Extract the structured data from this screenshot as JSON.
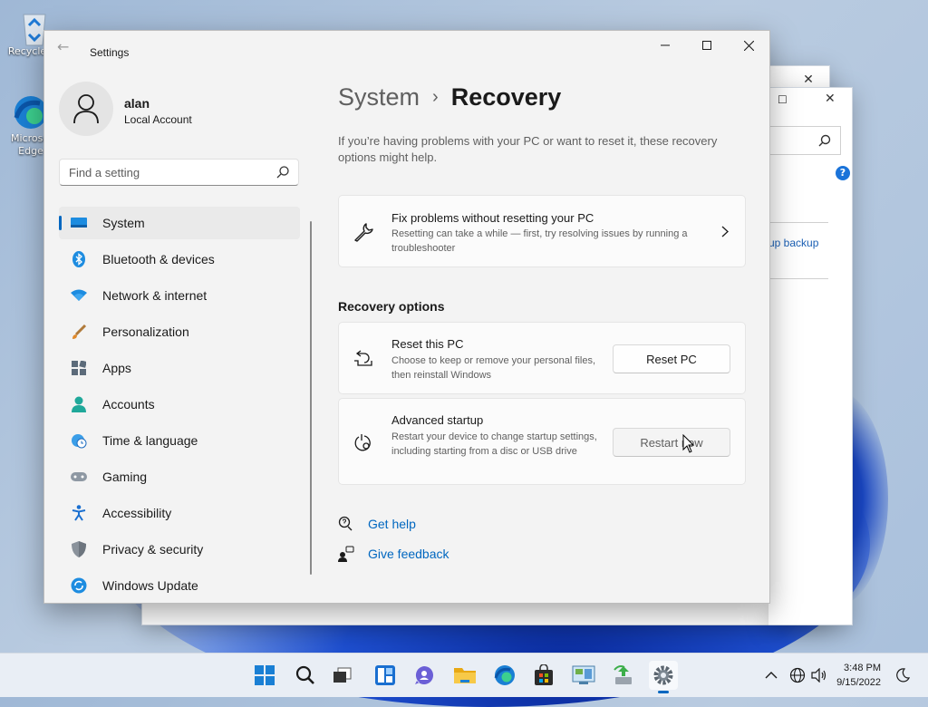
{
  "desktop": {
    "icons": [
      {
        "label": "Recycle",
        "icon": "recycle-bin-icon"
      },
      {
        "label": "Microsoft Edge",
        "icon": "edge-icon"
      }
    ]
  },
  "background_window": {
    "link_text": "up backup",
    "help_icon": "?"
  },
  "window": {
    "title": "Settings",
    "controls": [
      "minimize",
      "maximize",
      "close"
    ]
  },
  "profile": {
    "name": "alan",
    "account_type": "Local Account"
  },
  "search": {
    "placeholder": "Find a setting"
  },
  "nav": {
    "items": [
      {
        "label": "System",
        "icon": "monitor-icon",
        "active": true
      },
      {
        "label": "Bluetooth & devices",
        "icon": "bluetooth-icon"
      },
      {
        "label": "Network & internet",
        "icon": "wifi-icon"
      },
      {
        "label": "Personalization",
        "icon": "brush-icon"
      },
      {
        "label": "Apps",
        "icon": "apps-icon"
      },
      {
        "label": "Accounts",
        "icon": "person-icon"
      },
      {
        "label": "Time & language",
        "icon": "globe-clock-icon"
      },
      {
        "label": "Gaming",
        "icon": "gamepad-icon"
      },
      {
        "label": "Accessibility",
        "icon": "accessibility-icon"
      },
      {
        "label": "Privacy & security",
        "icon": "shield-icon"
      },
      {
        "label": "Windows Update",
        "icon": "update-icon"
      }
    ]
  },
  "breadcrumb": {
    "parent": "System",
    "separator": "›",
    "current": "Recovery"
  },
  "intro": "If you’re having problems with your PC or want to reset it, these recovery options might help.",
  "fix_card": {
    "title": "Fix problems without resetting your PC",
    "description": "Resetting can take a while — first, try resolving issues by running a troubleshooter",
    "icon": "wrench-icon"
  },
  "recovery_options": {
    "heading": "Recovery options",
    "reset": {
      "title": "Reset this PC",
      "description": "Choose to keep or remove your personal files, then reinstall Windows",
      "button": "Reset PC",
      "icon": "reset-pc-icon"
    },
    "advanced": {
      "title": "Advanced startup",
      "description": "Restart your device to change startup settings, including starting from a disc or USB drive",
      "button": "Restart now",
      "icon": "advanced-startup-icon"
    }
  },
  "links": [
    {
      "label": "Get help",
      "icon": "help-icon"
    },
    {
      "label": "Give feedback",
      "icon": "feedback-icon"
    }
  ],
  "taskbar": {
    "apps": [
      "start-icon",
      "search-icon",
      "task-view-icon",
      "widgets-icon",
      "chat-icon",
      "file-explorer-icon",
      "edge-icon",
      "store-icon",
      "control-panel-icon",
      "backup-icon",
      "settings-icon"
    ],
    "time": "3:48 PM",
    "date": "9/15/2022"
  },
  "colors": {
    "accent": "#0067c0",
    "window_bg": "#f3f3f3",
    "card_bg": "#fbfbfb"
  }
}
